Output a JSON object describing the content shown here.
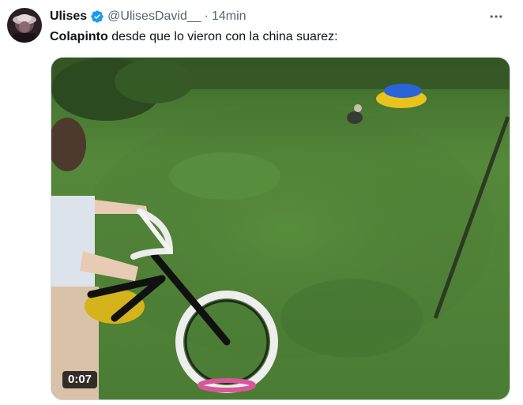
{
  "tweet": {
    "display_name": "Ulises",
    "verified_icon": "verified-badge-icon",
    "handle": "@UlisesDavid__",
    "separator": "·",
    "time": "14min",
    "more_icon": "more-options-icon",
    "text_mention": "Colapinto",
    "text_rest": " desde que lo vieron con la china suarez:"
  },
  "media": {
    "type": "video",
    "duration": "0:07"
  },
  "colors": {
    "verified": "#1d9bf0",
    "secondary_text": "#536471",
    "primary_text": "#0f1419",
    "grass": "#4a7a34"
  }
}
